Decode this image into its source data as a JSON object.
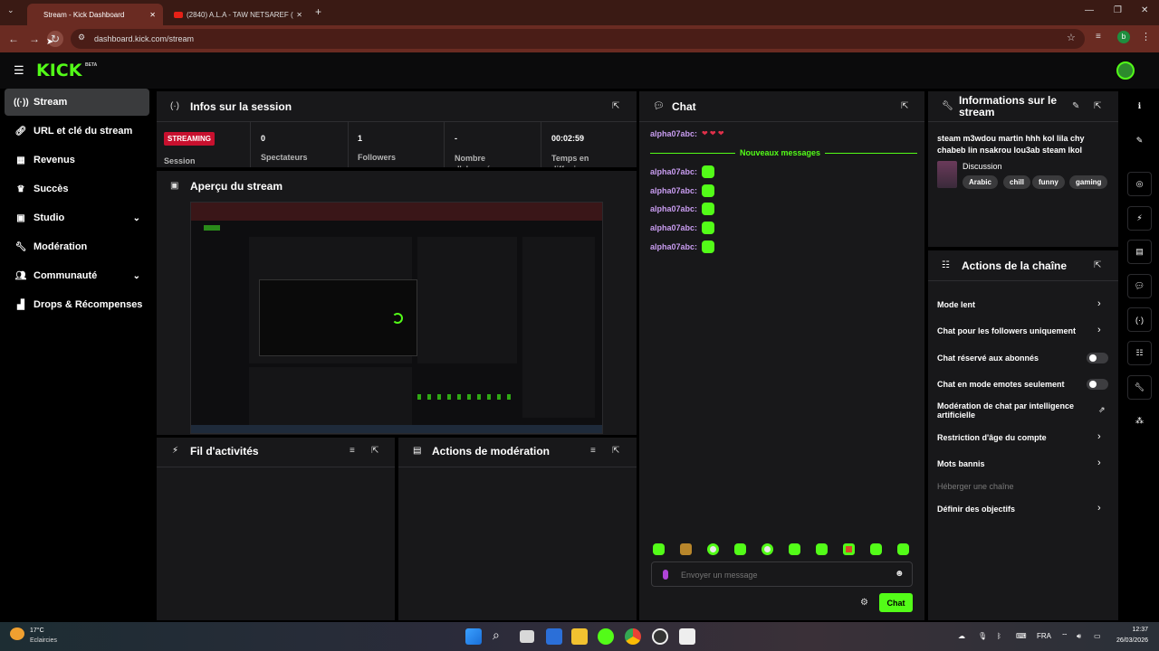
{
  "browser": {
    "tabs": [
      {
        "title": "Stream - Kick Dashboard",
        "active": true
      },
      {
        "title": "(2840) A.L.A - TAW NETSAREF (",
        "active": false
      }
    ],
    "url": "dashboard.kick.com/stream",
    "profile_initial": "b"
  },
  "brand": {
    "logo": "KICK",
    "beta": "BETA",
    "accent": "#53fc18"
  },
  "sidebar": {
    "items": [
      {
        "label": "Stream",
        "icon": "broadcast-icon",
        "active": true
      },
      {
        "label": "URL et clé du stream",
        "icon": "link-icon"
      },
      {
        "label": "Revenus",
        "icon": "revenue-icon"
      },
      {
        "label": "Succès",
        "icon": "trophy-icon"
      },
      {
        "label": "Studio",
        "icon": "studio-icon",
        "expandable": true
      },
      {
        "label": "Modération",
        "icon": "wrench-icon"
      },
      {
        "label": "Communauté",
        "icon": "users-icon",
        "expandable": true
      },
      {
        "label": "Drops & Récompenses",
        "icon": "drops-icon"
      }
    ]
  },
  "session": {
    "title": "Infos sur la session",
    "status_badge": "STREAMING",
    "status_label": "Session",
    "stats": [
      {
        "value": "0",
        "label": "Spectateurs"
      },
      {
        "value": "1",
        "label": "Followers"
      },
      {
        "value": "-",
        "label": "Nombre d'abonnés"
      },
      {
        "value": "00:02:59",
        "label": "Temps en diffusion"
      }
    ]
  },
  "preview": {
    "title": "Aperçu du stream"
  },
  "activity": {
    "title": "Fil d'activités"
  },
  "mod_actions": {
    "title": "Actions de modération"
  },
  "chat": {
    "title": "Chat",
    "new_messages": "Nouveaux messages",
    "messages": [
      {
        "user": "alpha07abc:",
        "content": "hearts"
      },
      {
        "user": "alpha07abc:",
        "content": "emote"
      },
      {
        "user": "alpha07abc:",
        "content": "emote"
      },
      {
        "user": "alpha07abc:",
        "content": "emote"
      },
      {
        "user": "alpha07abc:",
        "content": "emote"
      },
      {
        "user": "alpha07abc:",
        "content": "emote"
      }
    ],
    "input_placeholder": "Envoyer un message",
    "send_label": "Chat"
  },
  "stream_info": {
    "title": "Informations sur le stream",
    "stream_title": "steam m3wdou martin hhh kol lila chy chabeb lin nsakrou lou3ab steam lkol",
    "category": "Discussion",
    "tags": [
      "Arabic",
      "chill",
      "funny",
      "gaming"
    ]
  },
  "channel_actions": {
    "title": "Actions de la chaîne",
    "items": [
      {
        "label": "Mode lent",
        "control": "chevron"
      },
      {
        "label": "Chat pour les followers uniquement",
        "control": "chevron"
      },
      {
        "label": "Chat réservé aux abonnés",
        "control": "toggle",
        "on": false
      },
      {
        "label": "Chat en mode emotes seulement",
        "control": "toggle",
        "on": false
      },
      {
        "label": "Modération de chat par intelligence artificielle",
        "control": "external"
      },
      {
        "label": "Restriction d'âge du compte",
        "control": "chevron"
      },
      {
        "label": "Mots bannis",
        "control": "chevron"
      },
      {
        "label": "Héberger une chaîne",
        "control": "none",
        "disabled": true
      },
      {
        "label": "Définir des objectifs",
        "control": "chevron"
      }
    ]
  },
  "taskbar": {
    "weather_temp": "17°C",
    "weather_desc": "Eclaircies",
    "lang": "FRA",
    "time": "12:37",
    "date": "26/03/2026"
  }
}
